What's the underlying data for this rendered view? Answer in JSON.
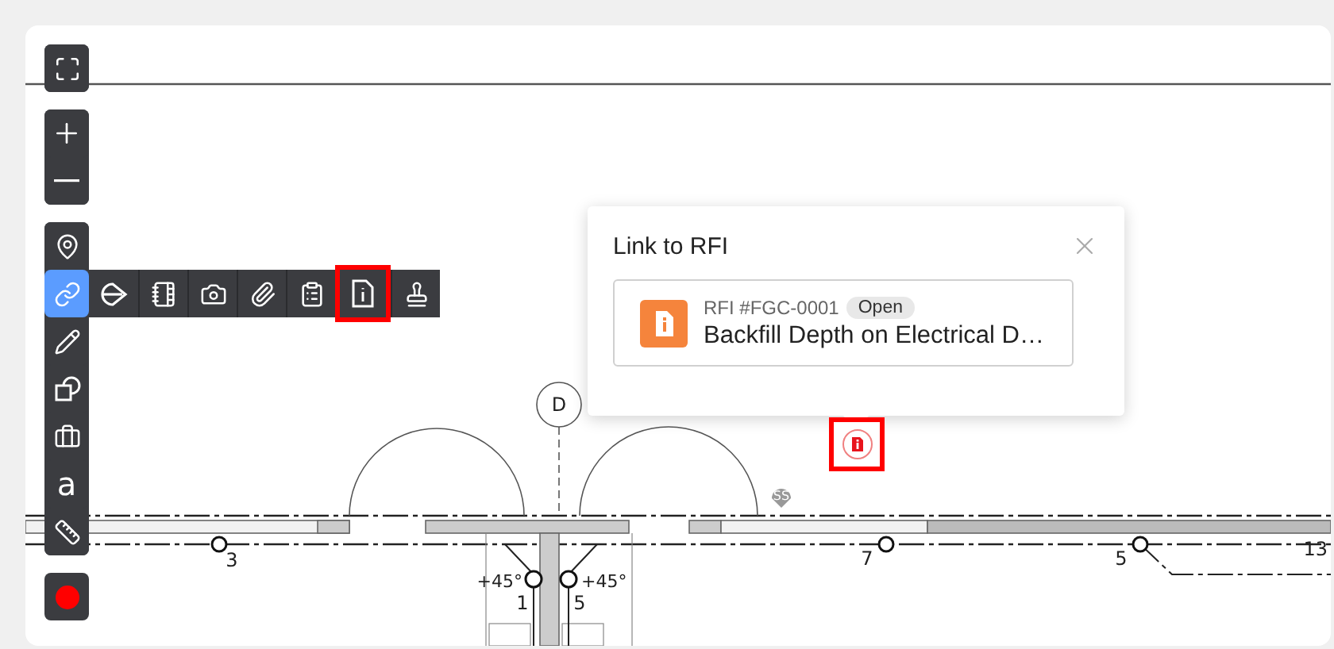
{
  "view_controls": [
    {
      "kind": "fullscreen"
    }
  ],
  "zoom_controls": [
    {
      "kind": "zoom-in"
    },
    {
      "kind": "zoom-out"
    }
  ],
  "tools": [
    {
      "kind": "pin",
      "selected": false
    },
    {
      "kind": "link",
      "selected": true
    },
    {
      "kind": "pencil",
      "selected": false
    },
    {
      "kind": "shapes",
      "selected": false
    },
    {
      "kind": "briefcase",
      "selected": false
    },
    {
      "kind": "text",
      "glyph": "a",
      "selected": false
    },
    {
      "kind": "ruler",
      "selected": false
    }
  ],
  "link_menu": [
    {
      "kind": "drawing",
      "highlighted": false
    },
    {
      "kind": "notebook",
      "highlighted": false
    },
    {
      "kind": "camera",
      "highlighted": false
    },
    {
      "kind": "paperclip",
      "highlighted": false
    },
    {
      "kind": "clipboard",
      "highlighted": false
    },
    {
      "kind": "rfi",
      "highlighted": true
    },
    {
      "kind": "stamp",
      "highlighted": false
    }
  ],
  "record_button": {
    "color": "#ff0000"
  },
  "popover": {
    "title": "Link to RFI",
    "item": {
      "number": "RFI #FGC-0001",
      "status": "Open",
      "title": "Backfill Depth on Electrical D…"
    }
  },
  "rfi_marker": {
    "highlighted": true
  },
  "sheet_labels": [
    {
      "text": "D"
    },
    {
      "text": "SS"
    },
    {
      "text": "3"
    },
    {
      "text": "7"
    },
    {
      "text": "5"
    },
    {
      "text": "13"
    },
    {
      "text": "+45°"
    },
    {
      "text": "+45°"
    },
    {
      "text": "1"
    },
    {
      "text": "5"
    }
  ]
}
